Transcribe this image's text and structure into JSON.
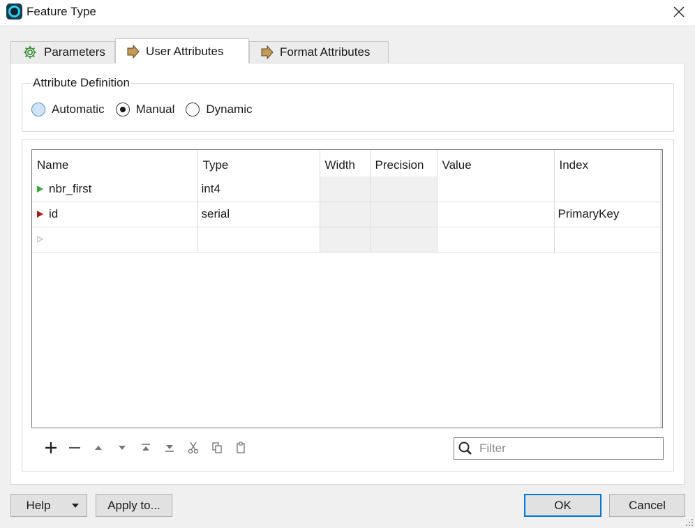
{
  "window": {
    "title": "Feature Type"
  },
  "tabs": [
    {
      "label": "Parameters",
      "icon": "gear-icon"
    },
    {
      "label": "User Attributes",
      "icon": "arrow-right-icon"
    },
    {
      "label": "Format Attributes",
      "icon": "arrow-right-icon"
    }
  ],
  "active_tab": "User Attributes",
  "attribute_definition": {
    "title": "Attribute Definition",
    "options": [
      "Automatic",
      "Manual",
      "Dynamic"
    ],
    "selected": "Manual"
  },
  "table": {
    "columns": [
      "Name",
      "Type",
      "Width",
      "Precision",
      "Value",
      "Index"
    ],
    "rows": [
      {
        "name": "nbr_first",
        "type": "int4",
        "width": "",
        "precision": "",
        "value": "",
        "index": "",
        "marker": "green"
      },
      {
        "name": "id",
        "type": "serial",
        "width": "",
        "precision": "",
        "value": "",
        "index": "PrimaryKey",
        "marker": "red"
      },
      {
        "name": "",
        "type": "",
        "width": "",
        "precision": "",
        "value": "",
        "index": "",
        "marker": "empty"
      }
    ]
  },
  "toolbar": {
    "icons": [
      "add-icon",
      "remove-icon",
      "move-up-icon",
      "move-down-icon",
      "move-top-icon",
      "move-bottom-icon",
      "cut-icon",
      "copy-icon",
      "paste-icon"
    ]
  },
  "filter": {
    "placeholder": "Filter",
    "value": ""
  },
  "buttons": {
    "help": "Help",
    "apply_to": "Apply to...",
    "ok": "OK",
    "cancel": "Cancel"
  },
  "colors": {
    "accent": "#0078d7",
    "marker_green": "#38a838",
    "marker_red": "#a61a1a",
    "tab_arrow": "#c49a56"
  }
}
